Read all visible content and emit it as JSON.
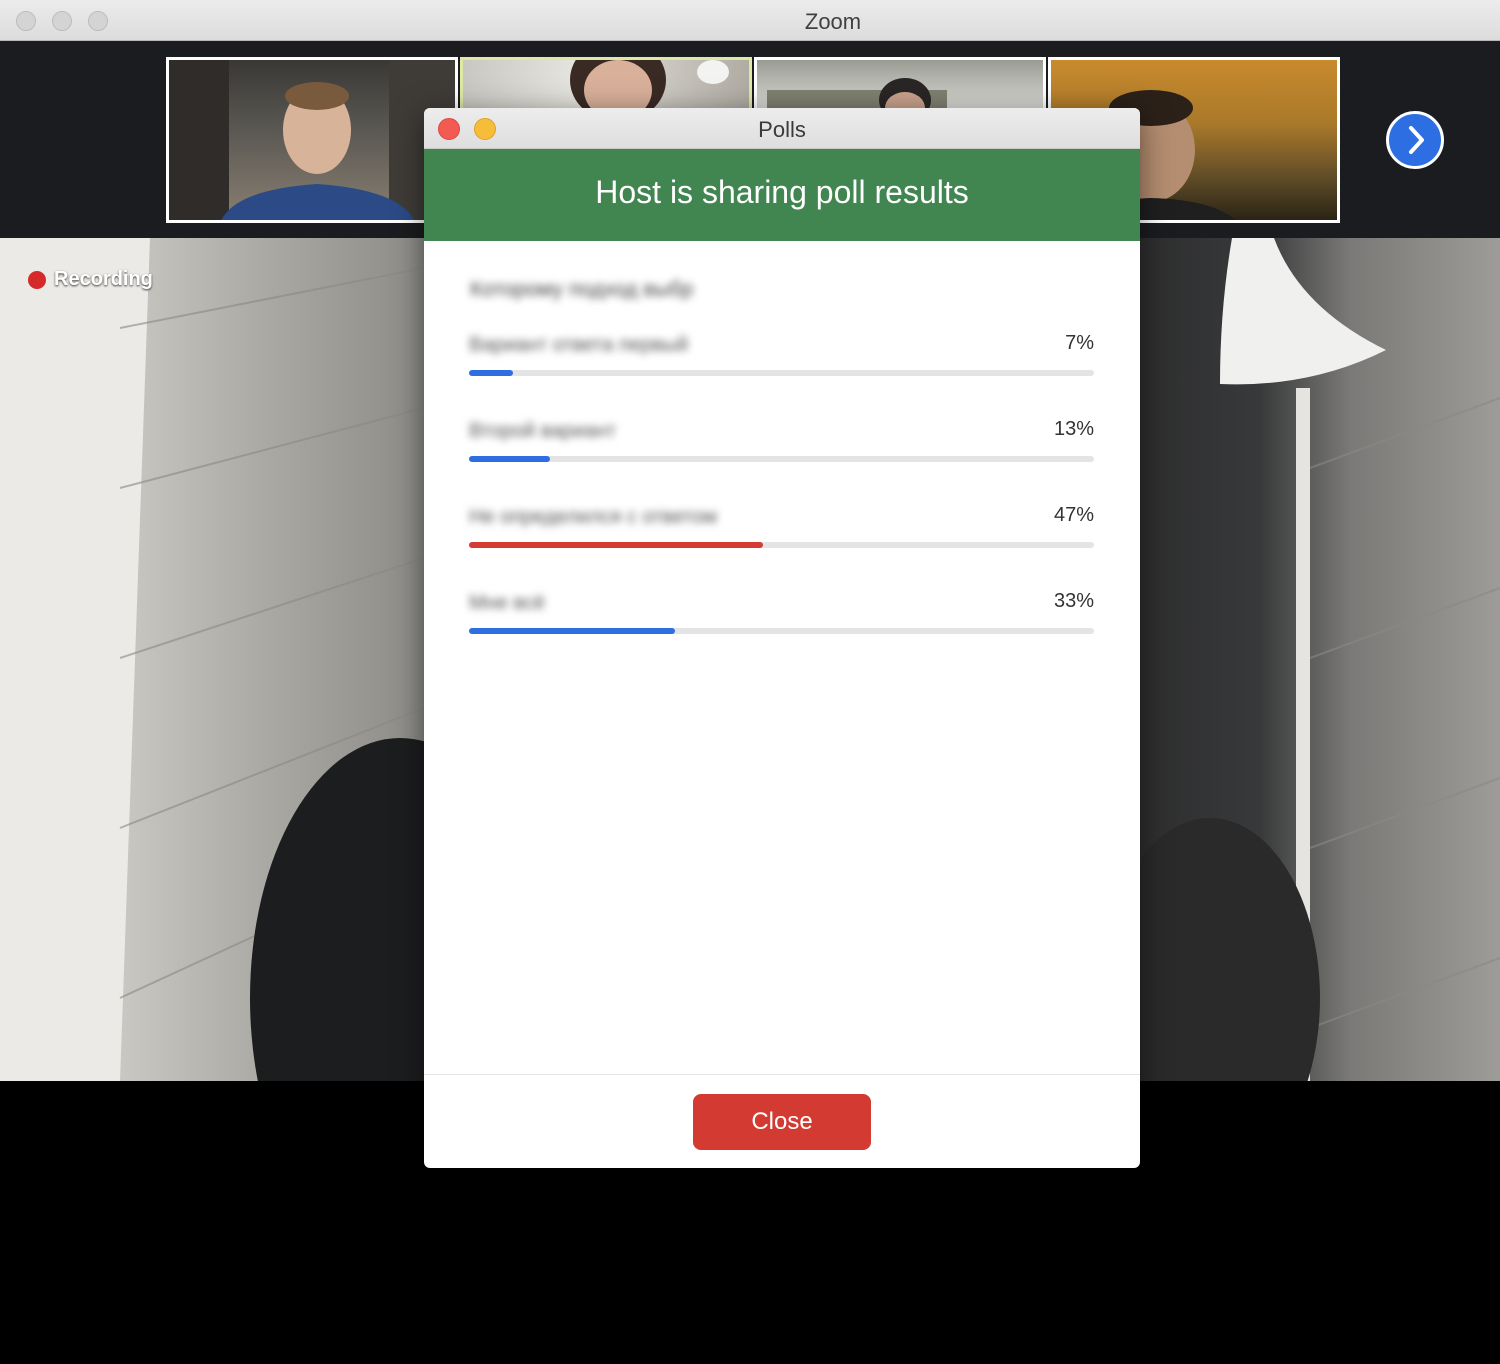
{
  "window": {
    "title": "Zoom"
  },
  "recording": {
    "label": "Recording"
  },
  "thumbnails": [
    {
      "name": "participant-1"
    },
    {
      "name": "participant-2"
    },
    {
      "name": "participant-3"
    },
    {
      "name": "participant-4"
    }
  ],
  "poll_dialog": {
    "title": "Polls",
    "banner": "Host is sharing poll results",
    "question": "Которому подход выбр",
    "options": [
      {
        "label": "Вариант ответа первый",
        "percent": "7%",
        "value": 7
      },
      {
        "label": "Второй вариант",
        "percent": "13%",
        "value": 13
      },
      {
        "label": "Не определился с ответом",
        "percent": "47%",
        "value": 47
      },
      {
        "label": "Мне всё",
        "percent": "33%",
        "value": 33
      }
    ],
    "close_label": "Close",
    "colors": {
      "banner": "#418550",
      "bar": "#2f6ee0",
      "bar_top": "#d33b33",
      "close_button": "#d33a31"
    }
  },
  "icons": {
    "next_page": "chevron-right-icon"
  }
}
